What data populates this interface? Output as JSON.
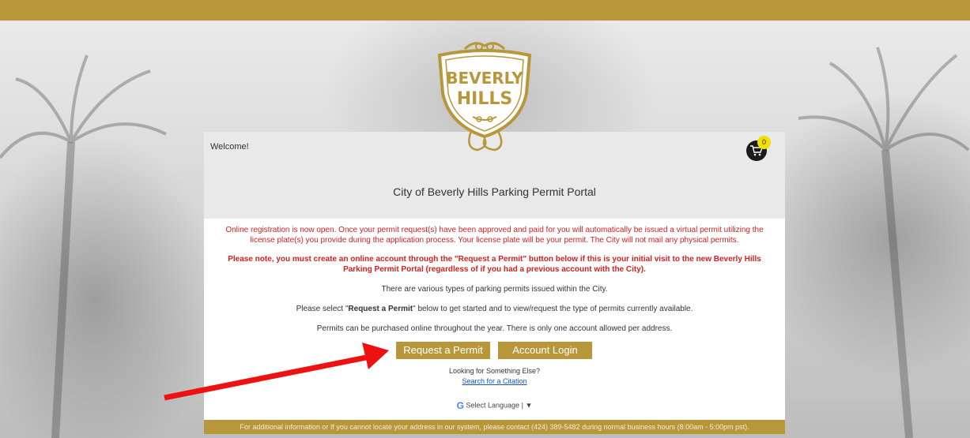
{
  "header": {
    "logo_text_line1": "BEVERLY",
    "logo_text_line2": "HILLS"
  },
  "panel": {
    "welcome": "Welcome!",
    "cart_count": "0",
    "title": "City of Beverly Hills Parking Permit Portal",
    "notice_red": "Online registration is now open. Once your permit request(s) have been approved and paid for you will automatically be issued a virtual permit utilizing the license plate(s) you provide during the application process. Your license plate will be your permit. The City will not mail any physical permits.",
    "notice_bold": "Please note, you must create an online account through the \"Request a Permit\" button below if this is your initial visit to the new Beverly Hills Parking Permit Portal (regardless of if you had a previous account with the City).",
    "info_types": "There are various types of parking permits issued within the City.",
    "info_select_prefix": "Please select \"",
    "info_select_bold": "Request a Permit",
    "info_select_suffix": "\" below to get started and to view/request the type of permits currently available.",
    "info_purchase": "Permits can be purchased online throughout the year. There is only one account allowed per address.",
    "request_button": "Request a Permit",
    "login_button": "Account Login",
    "looking": "Looking for Something Else?",
    "citation_link": "Search for a Citation",
    "select_language": "Select Language",
    "lang_caret": "▼"
  },
  "footer": {
    "text": "For additional information or If you cannot locate your address in our system, please contact (424) 389-5482 during normal business hours (8:00am - 5:00pm pst)."
  },
  "colors": {
    "gold": "#b8973b",
    "red": "#d42020",
    "link": "#1a55c7"
  }
}
